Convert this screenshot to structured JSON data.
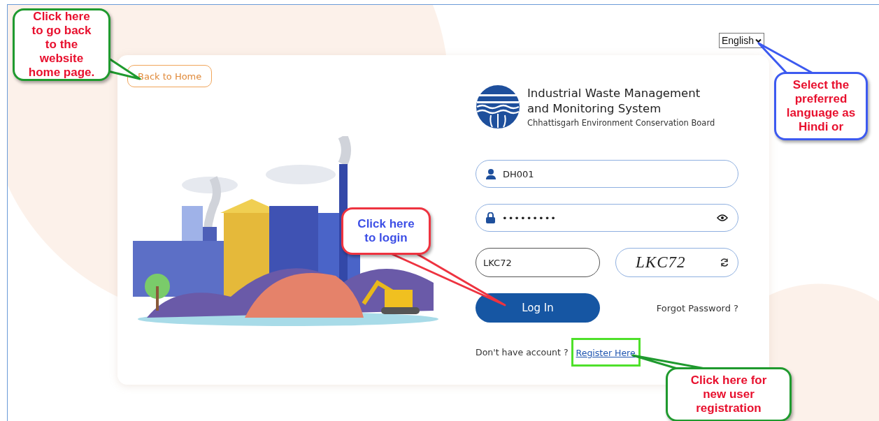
{
  "language_select": {
    "value": "English"
  },
  "back_button": {
    "label": "Back to Home"
  },
  "header": {
    "title_line_1": "Industrial Waste Management",
    "title_line_2": "and Monitoring System",
    "subtitle": "Chhattisgarh Environment Conservation Board"
  },
  "username_field": {
    "value": "DH001"
  },
  "password_field": {
    "value": "•••••••••"
  },
  "captcha_field": {
    "value": "LKC72"
  },
  "captcha_image": {
    "text": "LKC72"
  },
  "login_button": {
    "label": "Log In"
  },
  "forgot_link": {
    "label": "Forgot Password ?"
  },
  "register_prompt": {
    "text": "Don't have account ?",
    "link": "Register Here",
    "highlighted": true
  },
  "callouts": [
    {
      "text": "Click here to go back to the website home page.",
      "color": "#1f9a2e"
    },
    {
      "text": "Select the preferred language as Hindi or",
      "color": "#3d5af0"
    },
    {
      "text": "Click here to login",
      "color": "#ee3340"
    },
    {
      "text": "Click here for new user registration",
      "color": "#1f9a2e"
    }
  ]
}
